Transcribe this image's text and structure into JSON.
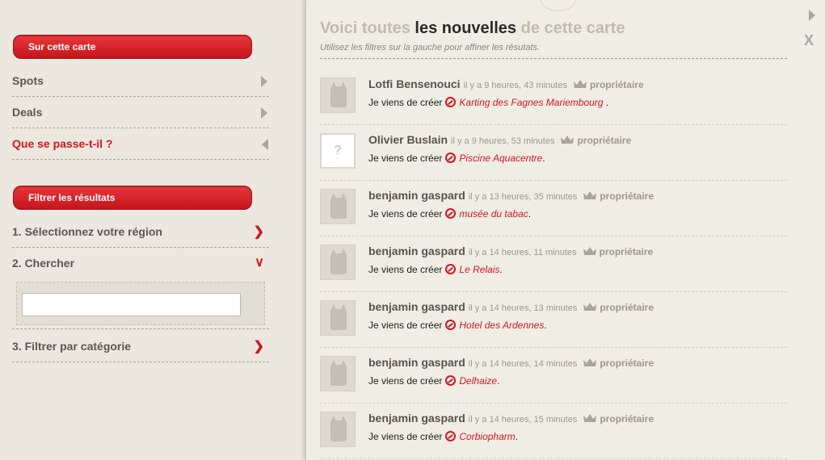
{
  "sidebar": {
    "section_header": "Sur cette carte",
    "nav": [
      {
        "label": "Spots",
        "active": false
      },
      {
        "label": "Deals",
        "active": false
      },
      {
        "label": "Que se passe-t-il ?",
        "active": true
      }
    ],
    "filter_header": "Filtrer les résultats",
    "filters": [
      {
        "label": "1. Sélectionnez votre région",
        "icon": "chevron-right-icon"
      },
      {
        "label": "2. Chercher",
        "icon": "chevron-down-icon"
      },
      {
        "label": "3. Filtrer par catégorie",
        "icon": "chevron-right-icon"
      }
    ],
    "search": {
      "value": "",
      "placeholder": ""
    }
  },
  "main": {
    "headline": {
      "part1": "Voici toutes ",
      "part2": "les nouvelles",
      "part3": " de cette carte"
    },
    "subtitle": "Utilisez les filtres sur la gauche pour affiner les résutats.",
    "close_label": "X",
    "feed": [
      {
        "user": "Lotfi Bensenouci",
        "time": "il y a 9 heures, 43 minutes",
        "role": "propriétaire",
        "action": "Je viens de créer",
        "place": "Karting des Fagnes Mariembourg",
        "suffix": " .",
        "avatar": "generic"
      },
      {
        "user": "Olivier Buslain",
        "time": "il y a 9 heures, 53 minutes",
        "role": "propriétaire",
        "action": "Je viens de créer",
        "place": "Piscine Aquacentre",
        "suffix": ".",
        "avatar": "unknown"
      },
      {
        "user": "benjamin gaspard",
        "time": "il y a 13 heures, 35 minutes",
        "role": "propriétaire",
        "action": "Je viens de créer",
        "place": "musée du tabac",
        "suffix": ".",
        "avatar": "generic"
      },
      {
        "user": "benjamin gaspard",
        "time": "il y a 14 heures, 11 minutes",
        "role": "propriétaire",
        "action": "Je viens de créer",
        "place": "Le Relais",
        "suffix": ".",
        "avatar": "generic"
      },
      {
        "user": "benjamin gaspard",
        "time": "il y a 14 heures, 13 minutes",
        "role": "propriétaire",
        "action": "Je viens de créer",
        "place": "Hotel des Ardennes",
        "suffix": ".",
        "avatar": "generic"
      },
      {
        "user": "benjamin gaspard",
        "time": "il y a 14 heures, 14 minutes",
        "role": "propriétaire",
        "action": "Je viens de créer",
        "place": "Delhaize",
        "suffix": ".",
        "avatar": "generic"
      },
      {
        "user": "benjamin gaspard",
        "time": "il y a 14 heures, 15 minutes",
        "role": "propriétaire",
        "action": "Je viens de créer",
        "place": "Corbiopharm",
        "suffix": ".",
        "avatar": "generic"
      }
    ]
  },
  "colors": {
    "accent": "#d0171e",
    "background": "#ece7df",
    "panel": "#f0ede5"
  }
}
